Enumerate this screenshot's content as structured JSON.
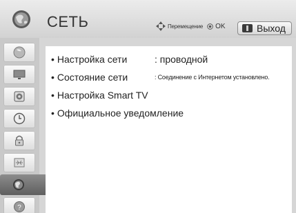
{
  "header": {
    "title": "СЕТЬ",
    "hint_move": "Перемещение",
    "hint_ok": "OK",
    "exit_label": "Выход",
    "icon": "globe-icon"
  },
  "sidebar": {
    "items": [
      {
        "icon": "picture-icon",
        "active": false
      },
      {
        "icon": "tv-screen-icon",
        "active": false
      },
      {
        "icon": "speaker-icon",
        "active": false
      },
      {
        "icon": "clock-icon",
        "active": false
      },
      {
        "icon": "lock-icon",
        "active": false
      },
      {
        "icon": "settings-box-icon",
        "active": false
      },
      {
        "icon": "network-globe-icon",
        "active": true
      },
      {
        "icon": "help-icon",
        "active": false
      }
    ]
  },
  "menu": {
    "items": [
      {
        "label": "Настройка сети",
        "value": ": проводной"
      },
      {
        "label": "Состояние сети",
        "value": ": Соединение с Интернетом установлено."
      },
      {
        "label": "Настройка Smart TV",
        "value": ""
      },
      {
        "label": "Официальное уведомление",
        "value": ""
      }
    ],
    "bullet": "•"
  },
  "colors": {
    "active_item": "#6f6f6f",
    "panel_bg": "#ffffff",
    "sidebar_bg": "#c9c9c9"
  }
}
